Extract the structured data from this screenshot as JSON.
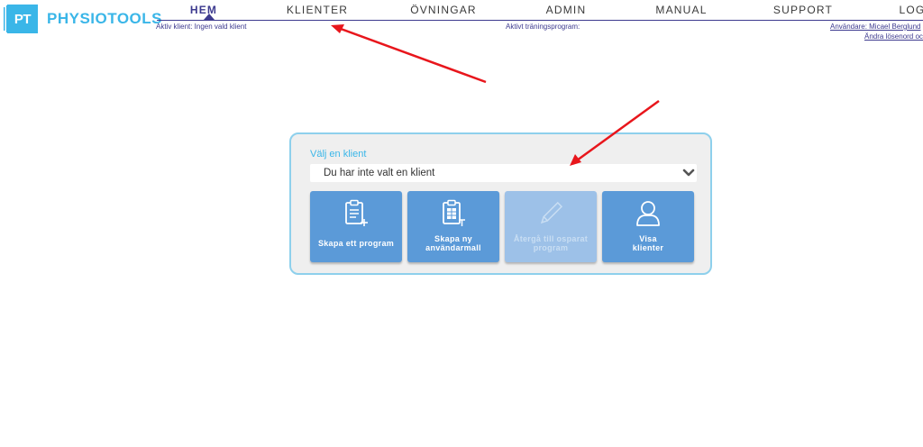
{
  "brand": {
    "logo_text": "PT",
    "name": "PHYSIOTOOLS"
  },
  "nav": {
    "items": [
      {
        "label": "HEM",
        "active": true
      },
      {
        "label": "KLIENTER",
        "active": false
      },
      {
        "label": "ÖVNINGAR",
        "active": false
      },
      {
        "label": "ADMIN",
        "active": false
      },
      {
        "label": "MANUAL",
        "active": false
      },
      {
        "label": "SUPPORT",
        "active": false
      },
      {
        "label": "LOG",
        "active": false
      }
    ]
  },
  "status": {
    "active_client": "Aktiv klient: Ingen vald klient",
    "active_program": "Aktivt träningsprogram:",
    "user": "Användare: Micael Berglund",
    "change_password": "Ändra lösenord och"
  },
  "client_panel": {
    "label": "Välj en klient",
    "select_value": "Du har inte valt en klient",
    "buttons": [
      {
        "label_lines": [
          "Skapa ett program"
        ],
        "icon": "clipboard-plus-icon",
        "enabled": true
      },
      {
        "label_lines": [
          "Skapa ny",
          "användarmall"
        ],
        "icon": "clipboard-template-icon",
        "enabled": true
      },
      {
        "label_lines": [
          "Återgå till osparat",
          "program"
        ],
        "icon": "pencil-icon",
        "enabled": false
      },
      {
        "label_lines": [
          "Visa",
          "klienter"
        ],
        "icon": "user-icon",
        "enabled": true
      }
    ]
  },
  "colors": {
    "brand": "#3ab6e8",
    "nav_accent": "#3d3a8f",
    "button": "#5b9ad8",
    "button_disabled": "#9dc1e8",
    "panel_border": "#8ed0ec",
    "annotation_arrow": "#e8161c"
  }
}
